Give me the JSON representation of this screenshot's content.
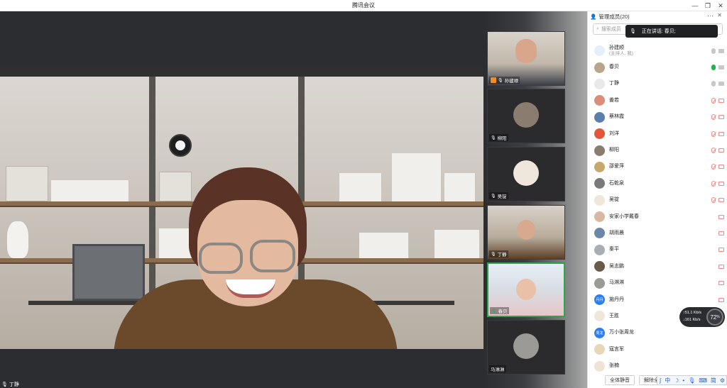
{
  "window": {
    "title": "腾讯会议",
    "controls": [
      "minimize-icon",
      "restore-icon",
      "close-icon"
    ]
  },
  "main_video": {
    "speaker_name": "丁静"
  },
  "gallery": [
    {
      "name": "孙建顺",
      "host": true
    },
    {
      "name": "柳阳",
      "host": false
    },
    {
      "name": "吴锭",
      "host": false
    },
    {
      "name": "丁静",
      "host": false
    },
    {
      "name": "春贝",
      "host": false,
      "active": true
    },
    {
      "name": "马淋淋",
      "host": false
    }
  ],
  "panel": {
    "title": "管理成员(20)",
    "search_placeholder": "搜索成员",
    "speaking_label": "正在讲话: 春贝;",
    "members": [
      {
        "name": "孙建顺",
        "sub": "(主持人, 我)",
        "mic": "gray",
        "cam": "gray",
        "avatar_color": "#e8eef9"
      },
      {
        "name": "春贝",
        "mic": "green",
        "cam": "gray",
        "avatar_color": "#b7a58c"
      },
      {
        "name": "丁静",
        "mic": "gray",
        "cam": "gray",
        "avatar_color": "#e9e9e9"
      },
      {
        "name": "姜若",
        "mic": "red",
        "cam": "red",
        "avatar_color": "#d98d7a"
      },
      {
        "name": "蔡林霞",
        "mic": "red",
        "cam": "red",
        "avatar_color": "#5b7fa8"
      },
      {
        "name": "刘洋",
        "mic": "red",
        "cam": "red",
        "avatar_color": "#e2573b"
      },
      {
        "name": "柳阳",
        "mic": "red",
        "cam": "red",
        "avatar_color": "#8a7d6f"
      },
      {
        "name": "邵爱萍",
        "mic": "red",
        "cam": "red",
        "avatar_color": "#c8a86a"
      },
      {
        "name": "石乾泉",
        "mic": "red",
        "cam": "red",
        "avatar_color": "#7a7a7a"
      },
      {
        "name": "吴锭",
        "mic": "red",
        "cam": "red",
        "avatar_color": "#efe6dc"
      },
      {
        "name": "安家小学戴春",
        "mic": "none",
        "cam": "red",
        "avatar_color": "#d9b7a3"
      },
      {
        "name": "胡雨晨",
        "mic": "none",
        "cam": "red",
        "avatar_color": "#6d87a8"
      },
      {
        "name": "秦平",
        "mic": "none",
        "cam": "red",
        "avatar_color": "#a9aeb4"
      },
      {
        "name": "吴志鹏",
        "mic": "none",
        "cam": "red",
        "avatar_color": "#6a5a4a"
      },
      {
        "name": "马淋淋",
        "mic": "none",
        "cam": "red",
        "avatar_color": "#9c9a96"
      },
      {
        "name": "施丹丹",
        "mic": "none",
        "cam": "red",
        "avatar_color": "#2d7ff0",
        "initials": "丹丹"
      },
      {
        "name": "王胜",
        "mic": "none",
        "cam": "none",
        "avatar_color": "#f1e6da"
      },
      {
        "name": "万小张周龙",
        "mic": "none",
        "cam": "none",
        "avatar_color": "#2d7ff0",
        "initials": "周龙"
      },
      {
        "name": "寇言军",
        "mic": "none",
        "cam": "none",
        "avatar_color": "#e7d7b8"
      },
      {
        "name": "张楠",
        "mic": "none",
        "cam": "none",
        "avatar_color": "#f1e3d4"
      }
    ],
    "footer": {
      "mute_all": "全体静音",
      "unmute_all": "解除全体静音"
    }
  },
  "network": {
    "up": "↑51.1 Kb/s",
    "down": "↓161 Kb/s",
    "percent": "72",
    "percent_suffix": "%"
  },
  "ime": {
    "mode": "中",
    "simplified": "简"
  }
}
